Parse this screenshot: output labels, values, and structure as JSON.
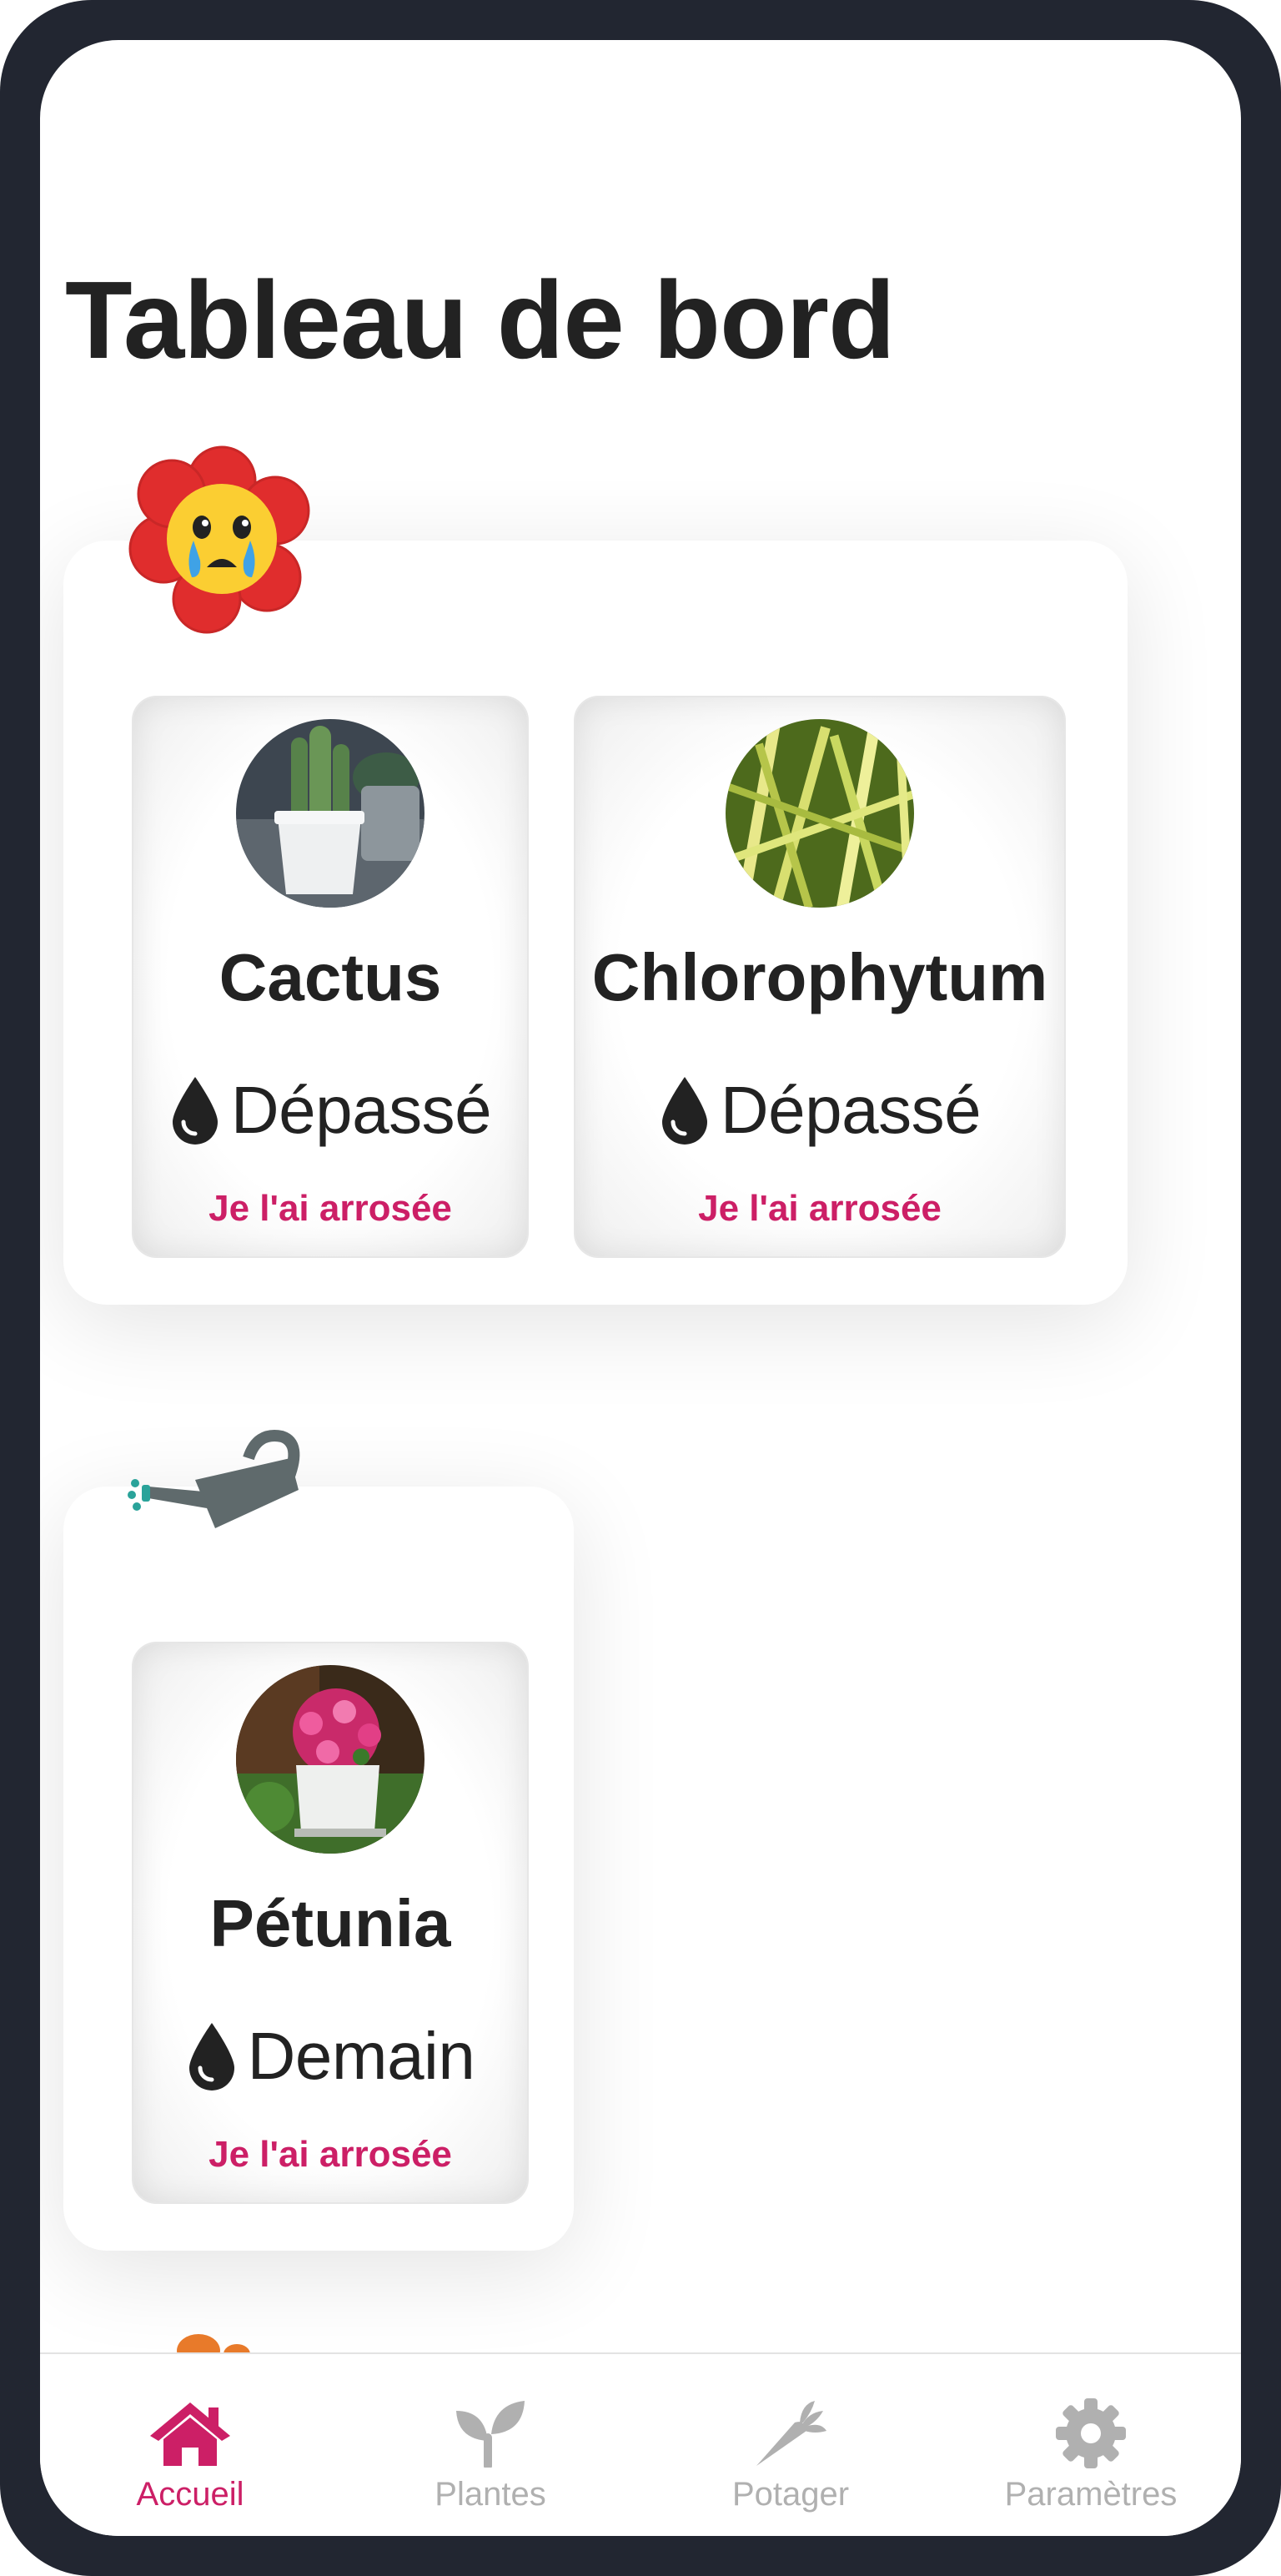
{
  "header": {
    "title": "Tableau de bord"
  },
  "groups": [
    {
      "badge_icon": "crying-flower-icon",
      "plants": [
        {
          "name": "Cactus",
          "photo_icon": "cactus-photo",
          "water_icon": "water-drop-icon",
          "status": "Dépassé",
          "action_label": "Je l'ai arrosée"
        },
        {
          "name": "Chlorophytum",
          "photo_icon": "chlorophytum-photo",
          "water_icon": "water-drop-icon",
          "status": "Dépassé",
          "action_label": "Je l'ai arrosée"
        }
      ]
    },
    {
      "badge_icon": "watering-can-icon",
      "plants": [
        {
          "name": "Pétunia",
          "photo_icon": "petunia-photo",
          "water_icon": "water-drop-icon",
          "status": "Demain",
          "action_label": "Je l'ai arrosée"
        }
      ]
    }
  ],
  "nav": {
    "active_index": 0,
    "items": [
      {
        "label": "Accueil",
        "icon": "home-icon"
      },
      {
        "label": "Plantes",
        "icon": "sprout-icon"
      },
      {
        "label": "Potager",
        "icon": "carrot-icon"
      },
      {
        "label": "Paramètres",
        "icon": "gear-icon"
      }
    ]
  },
  "colors": {
    "accent": "#cc1f66",
    "text": "#222222",
    "nav_inactive": "#b0b0b0",
    "frame": "#222631"
  }
}
